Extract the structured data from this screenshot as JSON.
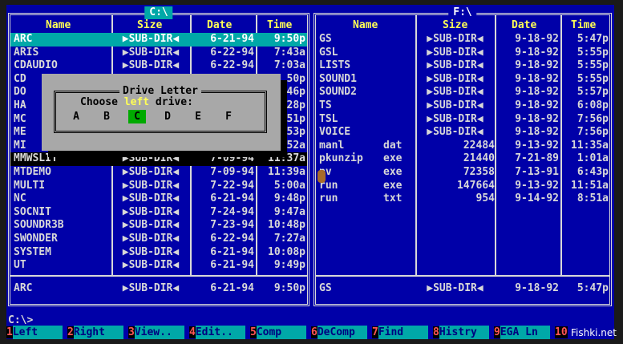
{
  "left_panel": {
    "title": "C:\\",
    "headers": {
      "name": "Name",
      "size": "Size",
      "date": "Date",
      "time": "Time"
    },
    "rows": [
      {
        "name": "ARC",
        "ext": "",
        "size": "▶SUB-DIR◀",
        "date": "6-21-94",
        "time": "9:50p",
        "state": "selected"
      },
      {
        "name": "ARIS",
        "ext": "",
        "size": "▶SUB-DIR◀",
        "date": "6-22-94",
        "time": "7:43a",
        "state": ""
      },
      {
        "name": "CDAUDIO",
        "ext": "",
        "size": "▶SUB-DIR◀",
        "date": "6-22-94",
        "time": "7:03a",
        "state": ""
      },
      {
        "name": "CD",
        "ext": "",
        "size": "",
        "date": "",
        "time": "50p",
        "state": ""
      },
      {
        "name": "DO",
        "ext": "",
        "size": "",
        "date": "",
        "time": "46p",
        "state": ""
      },
      {
        "name": "HA",
        "ext": "",
        "size": "",
        "date": "",
        "time": "28p",
        "state": ""
      },
      {
        "name": "MC",
        "ext": "",
        "size": "",
        "date": "",
        "time": "51p",
        "state": ""
      },
      {
        "name": "ME",
        "ext": "",
        "size": "",
        "date": "",
        "time": "53p",
        "state": ""
      },
      {
        "name": "MI",
        "ext": "",
        "size": "",
        "date": "",
        "time": "52a",
        "state": ""
      },
      {
        "name": "MMWSLIT",
        "ext": "",
        "size": "▶SUB-DIR◀",
        "date": "7-09-94",
        "time": "11:37a",
        "state": "cursor"
      },
      {
        "name": "MTDEMO",
        "ext": "",
        "size": "▶SUB-DIR◀",
        "date": "7-09-94",
        "time": "11:39a",
        "state": ""
      },
      {
        "name": "MULTI",
        "ext": "",
        "size": "▶SUB-DIR◀",
        "date": "7-22-94",
        "time": "5:00a",
        "state": ""
      },
      {
        "name": "NC",
        "ext": "",
        "size": "▶SUB-DIR◀",
        "date": "6-21-94",
        "time": "9:48p",
        "state": ""
      },
      {
        "name": "SOCNIT",
        "ext": "",
        "size": "▶SUB-DIR◀",
        "date": "7-24-94",
        "time": "9:47a",
        "state": ""
      },
      {
        "name": "SOUNDR3B",
        "ext": "",
        "size": "▶SUB-DIR◀",
        "date": "7-23-94",
        "time": "10:48p",
        "state": ""
      },
      {
        "name": "SWONDER",
        "ext": "",
        "size": "▶SUB-DIR◀",
        "date": "6-22-94",
        "time": "7:27a",
        "state": ""
      },
      {
        "name": "SYSTEM",
        "ext": "",
        "size": "▶SUB-DIR◀",
        "date": "6-21-94",
        "time": "10:08p",
        "state": ""
      },
      {
        "name": "UT",
        "ext": "",
        "size": "▶SUB-DIR◀",
        "date": "6-21-94",
        "time": "9:49p",
        "state": ""
      }
    ],
    "info": {
      "name": "ARC",
      "size": "▶SUB-DIR◀",
      "date": "6-21-94",
      "time": "9:50p"
    }
  },
  "right_panel": {
    "title": "F:\\",
    "headers": {
      "name": "Name",
      "size": "Size",
      "date": "Date",
      "time": "Time"
    },
    "rows": [
      {
        "name": "GS",
        "ext": "",
        "size": "▶SUB-DIR◀",
        "date": "9-18-92",
        "time": "5:47p"
      },
      {
        "name": "GSL",
        "ext": "",
        "size": "▶SUB-DIR◀",
        "date": "9-18-92",
        "time": "5:55p"
      },
      {
        "name": "LISTS",
        "ext": "",
        "size": "▶SUB-DIR◀",
        "date": "9-18-92",
        "time": "5:55p"
      },
      {
        "name": "SOUND1",
        "ext": "",
        "size": "▶SUB-DIR◀",
        "date": "9-18-92",
        "time": "5:55p"
      },
      {
        "name": "SOUND2",
        "ext": "",
        "size": "▶SUB-DIR◀",
        "date": "9-18-92",
        "time": "5:57p"
      },
      {
        "name": "TS",
        "ext": "",
        "size": "▶SUB-DIR◀",
        "date": "9-18-92",
        "time": "6:08p"
      },
      {
        "name": "TSL",
        "ext": "",
        "size": "▶SUB-DIR◀",
        "date": "9-18-92",
        "time": "7:56p"
      },
      {
        "name": "VOICE",
        "ext": "",
        "size": "▶SUB-DIR◀",
        "date": "9-18-92",
        "time": "7:56p"
      },
      {
        "name": "manl",
        "ext": "dat",
        "size": "22484",
        "date": "9-13-92",
        "time": "11:35a"
      },
      {
        "name": "pkunzip",
        "ext": "exe",
        "size": "21440",
        "date": "7-21-89",
        "time": "1:01a"
      },
      {
        "name": "pv",
        "ext": "exe",
        "size": "72358",
        "date": "7-13-91",
        "time": "6:43p"
      },
      {
        "name": "run",
        "ext": "exe",
        "size": "147664",
        "date": "9-13-92",
        "time": "11:51a"
      },
      {
        "name": "run",
        "ext": "txt",
        "size": "954",
        "date": "9-14-92",
        "time": "8:51a"
      }
    ],
    "info": {
      "name": "GS",
      "size": "▶SUB-DIR◀",
      "date": "9-18-92",
      "time": "5:47p"
    }
  },
  "dialog": {
    "title": "Drive Letter",
    "prompt_before": "Choose ",
    "prompt_highlight": "left",
    "prompt_after": " drive:",
    "drives": [
      "A",
      "B",
      "C",
      "D",
      "E",
      "F"
    ],
    "selected_drive": "C"
  },
  "command_line": "C:\\>",
  "keybar": [
    {
      "num": "1",
      "label": "Left"
    },
    {
      "num": "2",
      "label": "Right"
    },
    {
      "num": "3",
      "label": "View.."
    },
    {
      "num": "4",
      "label": "Edit.."
    },
    {
      "num": "5",
      "label": "Comp"
    },
    {
      "num": "6",
      "label": "DeComp"
    },
    {
      "num": "7",
      "label": "Find"
    },
    {
      "num": "8",
      "label": "Histry"
    },
    {
      "num": "9",
      "label": "EGA Ln"
    },
    {
      "num": "10",
      "label": ""
    }
  ],
  "watermark": "Fishki.net",
  "colors": {
    "panel_bg": "#0000a8",
    "header": "#ffff55",
    "selection": "#00a8a8",
    "dialog_bg": "#a8a8a8",
    "drive_selected": "#00aa00",
    "key_number": "#ff5555"
  }
}
